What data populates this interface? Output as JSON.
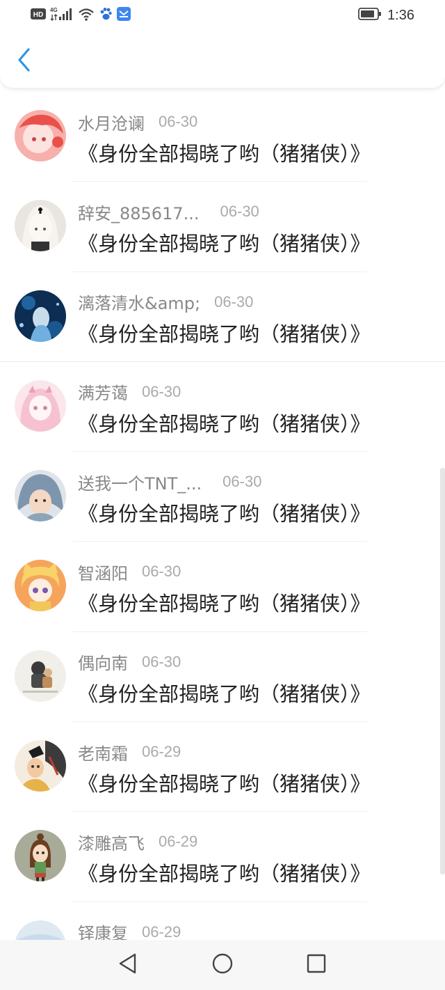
{
  "status_bar": {
    "network_badge": "HD",
    "network_type": "4G",
    "time": "1:36"
  },
  "header": {
    "back_icon": "chevron-left-icon",
    "accent_color": "#2f95e6"
  },
  "list": {
    "items": [
      {
        "user": "水月沧谰",
        "date": "06-30",
        "title": "《身份全部揭晓了哟（猪猪侠）》"
      },
      {
        "user": "辞安_885617...",
        "date": "06-30",
        "title": "《身份全部揭晓了哟（猪猪侠）》"
      },
      {
        "user": "漓落清水&amp;",
        "date": "06-30",
        "title": "《身份全部揭晓了哟（猪猪侠）》"
      },
      {
        "user": "满芳蔼",
        "date": "06-30",
        "title": "《身份全部揭晓了哟（猪猪侠）》"
      },
      {
        "user": "送我一个TNT_...",
        "date": "06-30",
        "title": "《身份全部揭晓了哟（猪猪侠）》"
      },
      {
        "user": "智涵阳",
        "date": "06-30",
        "title": "《身份全部揭晓了哟（猪猪侠）》"
      },
      {
        "user": "偶向南",
        "date": "06-30",
        "title": "《身份全部揭晓了哟（猪猪侠）》"
      },
      {
        "user": "老南霜",
        "date": "06-29",
        "title": "《身份全部揭晓了哟（猪猪侠）》"
      },
      {
        "user": "漆雕高飞",
        "date": "06-29",
        "title": "《身份全部揭晓了哟（猪猪侠）》"
      },
      {
        "user": "铎康复",
        "date": "06-29",
        "title": ""
      }
    ]
  },
  "nav_bar": {
    "back": "triangle-back-icon",
    "home": "circle-home-icon",
    "recents": "square-recents-icon"
  }
}
